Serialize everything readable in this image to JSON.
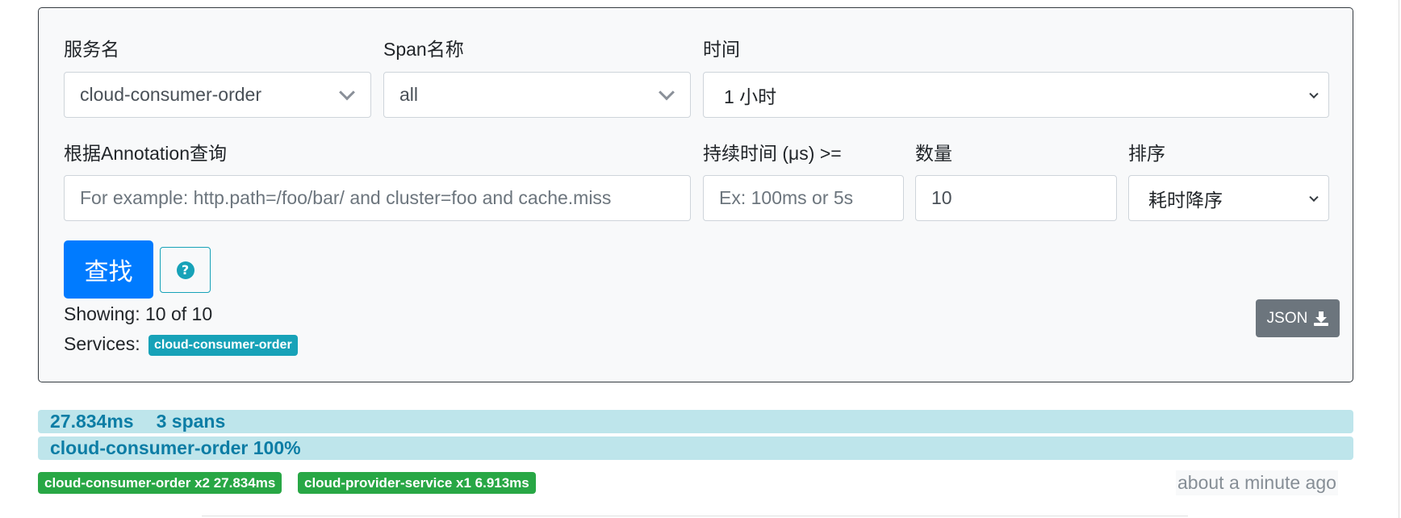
{
  "search_form": {
    "service_name_label": "服务名",
    "service_name_value": "cloud-consumer-order",
    "span_name_label": "Span名称",
    "span_name_value": "all",
    "time_label": "时间",
    "time_value": "1 小时",
    "annotation_label": "根据Annotation查询",
    "annotation_placeholder": "For example: http.path=/foo/bar/ and cluster=foo and cache.miss",
    "duration_label": "持续时间 (μs) >=",
    "duration_placeholder": "Ex: 100ms or 5s",
    "limit_label": "数量",
    "limit_value": "10",
    "sort_label": "排序",
    "sort_value": "耗时降序",
    "find_button": "查找",
    "help_icon": "question-circle-icon",
    "showing_text": "Showing: 10 of 10",
    "services_label": "Services:",
    "services_badge": "cloud-consumer-order",
    "json_button": "JSON",
    "json_icon": "download-icon"
  },
  "results": [
    {
      "duration": "27.834ms",
      "spans": "3 spans",
      "service_percent": "cloud-consumer-order 100%",
      "badges": [
        "cloud-consumer-order x2 27.834ms",
        "cloud-provider-service x1 6.913ms"
      ],
      "timestamp": "about a minute ago"
    }
  ],
  "colors": {
    "primary": "#007bff",
    "info": "#17a2b8",
    "success": "#28a745",
    "secondary": "#6c757d",
    "bar_bg": "#bee5eb",
    "bar_text": "#0c7da5"
  }
}
